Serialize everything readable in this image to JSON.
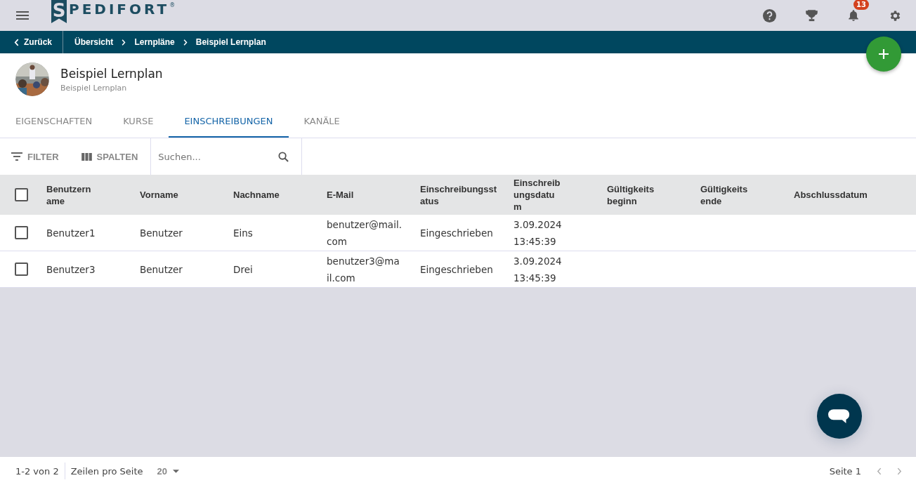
{
  "logo": {
    "initial": "S",
    "rest": "PEDIFORT",
    "mark": "®"
  },
  "notifications": {
    "count": "13"
  },
  "breadcrumb": {
    "back": "Zurück",
    "items": [
      "Übersicht",
      "Lernpläne",
      "Beispiel Lernplan"
    ]
  },
  "header": {
    "title": "Beispiel Lernplan",
    "subtitle": "Beispiel Lernplan"
  },
  "tabs": [
    {
      "label": "EIGENSCHAFTEN",
      "selected": false
    },
    {
      "label": "KURSE",
      "selected": false
    },
    {
      "label": "EINSCHREIBUNGEN",
      "selected": true
    },
    {
      "label": "KANÄLE",
      "selected": false
    }
  ],
  "toolbar": {
    "filter": "FILTER",
    "columns": "SPALTEN",
    "search": {
      "placeholder": "Suchen..."
    }
  },
  "table": {
    "all_checked": false,
    "columns": [
      "Benutzern\name",
      "Vorname",
      "Nachname",
      "E-Mail",
      "Einschreibungsst\natus",
      "Einschreib\nungsdatu\nm",
      "Gültigkeits\nbeginn",
      "Gültigkeits\nende",
      "Abschlussdatum"
    ],
    "rows": [
      {
        "checked": false,
        "cells": [
          "Benutzer1",
          "Benutzer",
          "Eins",
          "benutzer@mail.\ncom",
          "Eingeschrieben",
          "3.09.2024\n13:45:39",
          "",
          "",
          ""
        ]
      },
      {
        "checked": false,
        "cells": [
          "Benutzer3",
          "Benutzer",
          "Drei",
          "benutzer3@ma\nil.com",
          "Eingeschrieben",
          "3.09.2024\n13:45:39",
          "",
          "",
          ""
        ]
      }
    ]
  },
  "footer": {
    "range": "1-2 von 2",
    "rows_label": "Zeilen pro Seite",
    "rows_value": "20",
    "page": "Seite 1"
  }
}
